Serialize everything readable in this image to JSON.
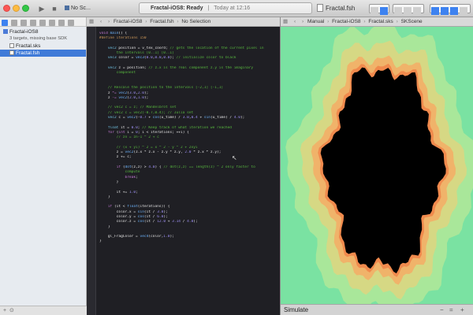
{
  "toolbar": {
    "scheme": "No Sc...",
    "activity_project": "Fractal-iOS8:",
    "activity_status": "Ready",
    "activity_time": "Today at 12:16",
    "tab_file": "Fractal.fsh"
  },
  "navigator": {
    "project": "Fractal-iOS8",
    "project_subtitle": "3 targets, missing base SDK",
    "files": [
      "Fractal.sks",
      "Fractal.fsh"
    ],
    "selected_file": "Fractal.fsh"
  },
  "editor_jumpbar": {
    "project": "Fractal-iOS8",
    "file": "Fractal.fsh",
    "tail": "No Selection"
  },
  "preview_jumpbar": {
    "label": "Manual",
    "project": "Fractal-iOS8",
    "file": "Fractal.sks",
    "scene": "SKScene"
  },
  "preview": {
    "footer_label": "Simulate",
    "colors": {
      "background": "#7ae2a2",
      "band1": "#a9e79a",
      "band2": "#d6d884",
      "band3": "#f0b36a",
      "band4": "#f08a4d",
      "set": "#000000"
    }
  },
  "code_lines": [
    [
      [
        "kw",
        "void"
      ],
      [
        "t",
        " "
      ],
      [
        "fn",
        "main"
      ],
      [
        "t",
        "() {"
      ]
    ],
    [
      [
        "pp",
        "#define iterations 150"
      ]
    ],
    [
      [
        "t",
        ""
      ]
    ],
    [
      [
        "t",
        "    "
      ],
      [
        "ty",
        "vec2"
      ],
      [
        "t",
        " position = v_tex_coord; "
      ],
      [
        "cm",
        "// gets the location of the current pixel in"
      ]
    ],
    [
      [
        "cm",
        "        the intervals [0..1] [0..1]"
      ]
    ],
    [
      [
        "t",
        "    "
      ],
      [
        "ty",
        "vec3"
      ],
      [
        "t",
        " color = "
      ],
      [
        "fn",
        "vec3"
      ],
      [
        "t",
        "("
      ],
      [
        "num",
        "0.0"
      ],
      [
        "t",
        ","
      ],
      [
        "num",
        "0.0"
      ],
      [
        "t",
        ","
      ],
      [
        "num",
        "0.0"
      ],
      [
        "t",
        "); "
      ],
      [
        "cm",
        "// initialize color to black"
      ]
    ],
    [
      [
        "t",
        ""
      ]
    ],
    [
      [
        "t",
        "    "
      ],
      [
        "ty",
        "vec2"
      ],
      [
        "t",
        " z = position; "
      ],
      [
        "cm",
        "// z.x is the real component z.y is the imaginary"
      ]
    ],
    [
      [
        "cm",
        "        component"
      ]
    ],
    [
      [
        "t",
        ""
      ]
    ],
    [
      [
        "t",
        ""
      ]
    ],
    [
      [
        "cm",
        "    // Rescale the position to the intervals [-2,1] [-1,1]"
      ]
    ],
    [
      [
        "t",
        "    z "
      ],
      [
        "kw",
        "*="
      ],
      [
        "t",
        " "
      ],
      [
        "fn",
        "vec2"
      ],
      [
        "t",
        "("
      ],
      [
        "num",
        "3.0"
      ],
      [
        "t",
        ","
      ],
      [
        "num",
        "2.0"
      ],
      [
        "t",
        ");"
      ]
    ],
    [
      [
        "t",
        "    z "
      ],
      [
        "kw",
        "-="
      ],
      [
        "t",
        " "
      ],
      [
        "fn",
        "vec2"
      ],
      [
        "t",
        "("
      ],
      [
        "num",
        "2.0"
      ],
      [
        "t",
        ","
      ],
      [
        "num",
        "1.0"
      ],
      [
        "t",
        ");"
      ]
    ],
    [
      [
        "t",
        ""
      ]
    ],
    [
      [
        "cm",
        "    // vec2 c = z; // Mandelbrot set"
      ]
    ],
    [
      [
        "cm",
        "    // vec2 c = vec2(-0.7,0.4); // Julia set"
      ]
    ],
    [
      [
        "t",
        "    "
      ],
      [
        "ty",
        "vec2"
      ],
      [
        "t",
        " c = "
      ],
      [
        "fn",
        "vec2"
      ],
      [
        "t",
        "(-"
      ],
      [
        "num",
        "0.7"
      ],
      [
        "t",
        " + "
      ],
      [
        "fn",
        "cos"
      ],
      [
        "t",
        "(u_time) / "
      ],
      [
        "num",
        "3.0"
      ],
      [
        "t",
        ","
      ],
      [
        "num",
        "0.4"
      ],
      [
        "t",
        " + "
      ],
      [
        "fn",
        "sin"
      ],
      [
        "t",
        "(u_time) / "
      ],
      [
        "num",
        "4.0"
      ],
      [
        "t",
        ");"
      ]
    ],
    [
      [
        "t",
        ""
      ]
    ],
    [
      [
        "t",
        "    "
      ],
      [
        "ty",
        "float"
      ],
      [
        "t",
        " it = "
      ],
      [
        "num",
        "0.0"
      ],
      [
        "t",
        "; "
      ],
      [
        "cm",
        "// Keep track of what iteration we reached"
      ]
    ],
    [
      [
        "t",
        "    "
      ],
      [
        "kw",
        "for"
      ],
      [
        "t",
        " ("
      ],
      [
        "kw",
        "int"
      ],
      [
        "t",
        " i = "
      ],
      [
        "num",
        "0"
      ],
      [
        "t",
        "; i < iterations; ++i) {"
      ]
    ],
    [
      [
        "cm",
        "        // zn = zn-1 ^ 2 + c"
      ]
    ],
    [
      [
        "t",
        ""
      ]
    ],
    [
      [
        "cm",
        "        // (x + yi) ^ 2 = x ^ 2 - y ^ 2 + 2xyi"
      ]
    ],
    [
      [
        "t",
        "        z = "
      ],
      [
        "fn",
        "vec2"
      ],
      [
        "t",
        "(z.x * z.x - z.y * z.y, "
      ],
      [
        "num",
        "2.0"
      ],
      [
        "t",
        " * z.x * z.y);"
      ]
    ],
    [
      [
        "t",
        "        z += c;"
      ]
    ],
    [
      [
        "t",
        ""
      ]
    ],
    [
      [
        "t",
        "        "
      ],
      [
        "kw",
        "if"
      ],
      [
        "t",
        " ("
      ],
      [
        "fn",
        "dot"
      ],
      [
        "t",
        "(z,z) > "
      ],
      [
        "num",
        "4.0"
      ],
      [
        "t",
        ") { "
      ],
      [
        "cm",
        "// dot(z,z) == length(z) ^ 2 only faster to"
      ]
    ],
    [
      [
        "cm",
        "            compute"
      ]
    ],
    [
      [
        "t",
        "            "
      ],
      [
        "kw",
        "break"
      ],
      [
        "t",
        ";"
      ]
    ],
    [
      [
        "t",
        "        }"
      ]
    ],
    [
      [
        "t",
        ""
      ]
    ],
    [
      [
        "t",
        "        it += "
      ],
      [
        "num",
        "1.0"
      ],
      [
        "t",
        ";"
      ]
    ],
    [
      [
        "t",
        "    }"
      ]
    ],
    [
      [
        "t",
        ""
      ]
    ],
    [
      [
        "t",
        "    "
      ],
      [
        "kw",
        "if"
      ],
      [
        "t",
        " (it < "
      ],
      [
        "fn",
        "float"
      ],
      [
        "t",
        "(iterations)) {"
      ]
    ],
    [
      [
        "t",
        "        color.x = "
      ],
      [
        "fn",
        "sin"
      ],
      [
        "t",
        "(it / "
      ],
      [
        "num",
        "3.0"
      ],
      [
        "t",
        ");"
      ]
    ],
    [
      [
        "t",
        "        color.y = "
      ],
      [
        "fn",
        "cos"
      ],
      [
        "t",
        "(it / "
      ],
      [
        "num",
        "6.0"
      ],
      [
        "t",
        ");"
      ]
    ],
    [
      [
        "t",
        "        color.z = "
      ],
      [
        "fn",
        "cos"
      ],
      [
        "t",
        "(it / "
      ],
      [
        "num",
        "12.0"
      ],
      [
        "t",
        " + "
      ],
      [
        "num",
        "3.14"
      ],
      [
        "t",
        " / "
      ],
      [
        "num",
        "4.0"
      ],
      [
        "t",
        ");"
      ]
    ],
    [
      [
        "t",
        "    }"
      ]
    ],
    [
      [
        "t",
        ""
      ]
    ],
    [
      [
        "t",
        "    gl_FragColor = "
      ],
      [
        "fn",
        "vec4"
      ],
      [
        "t",
        "(color,"
      ],
      [
        "num",
        "1.0"
      ],
      [
        "t",
        ");"
      ]
    ],
    [
      [
        "t",
        "}"
      ]
    ]
  ]
}
